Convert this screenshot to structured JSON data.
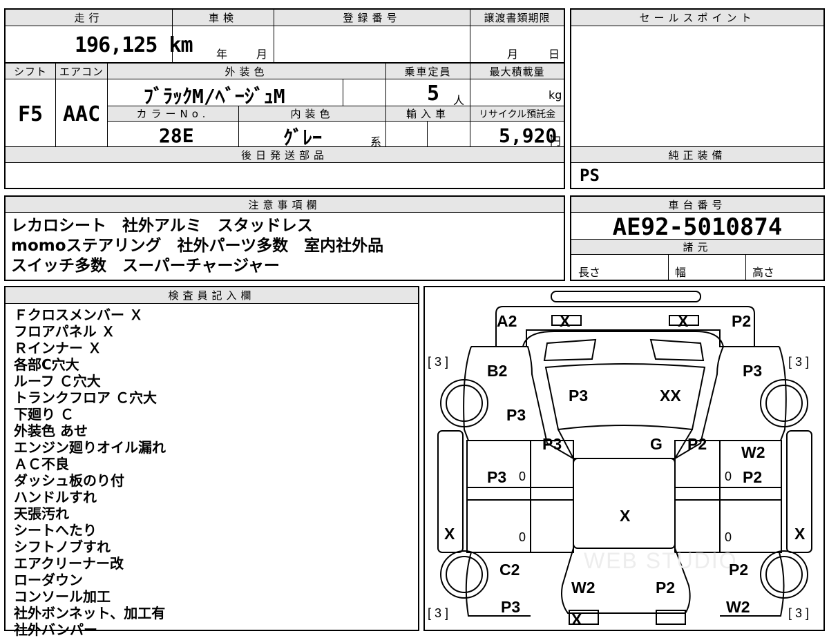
{
  "spec": {
    "mileage_label": "走行",
    "mileage": "196,125 km",
    "inspection_label": "車検",
    "inspection_year": "年",
    "inspection_month": "月",
    "registration_label": "登録番号",
    "transfer_label": "譲渡書類期限",
    "transfer_month": "月",
    "transfer_day": "日",
    "shift_label": "シフト",
    "shift": "F5",
    "aircon_label": "エアコン",
    "aircon": "AAC",
    "exterior_color_label": "外装色",
    "exterior_color": "ﾌﾞﾗｯｸM/ﾍﾞｰｼﾞｭM",
    "capacity_label": "乗車定員",
    "capacity": "5",
    "capacity_unit": "人",
    "max_load_label": "最大積載量",
    "max_load_unit": "kg",
    "color_no_label": "カラーNo.",
    "color_no": "28E",
    "interior_color_label": "内装色",
    "interior_color": "ｸﾞﾚｰ",
    "interior_suffix": "系",
    "import_label": "輸入車",
    "recycle_label": "リサイクル預託金",
    "recycle": "5,920",
    "recycle_unit": "円",
    "later_parts_label": "後日発送部品"
  },
  "sales": {
    "label": "セールスポイント",
    "genuine_label": "純正装備",
    "genuine": "PS"
  },
  "notes": {
    "label": "注意事項欄",
    "lines": [
      "レカロシート　社外アルミ　スタッドレス",
      "momoステアリング　社外パーツ多数　室内社外品",
      "スイッチ多数　スーパーチャージャー"
    ]
  },
  "chassis": {
    "label": "車台番号",
    "number": "AE92-5010874",
    "specs_label": "諸元",
    "length": "長さ",
    "width": "幅",
    "height": "高さ"
  },
  "inspector": {
    "label": "検査員記入欄",
    "lines": [
      "Ｆクロスメンバー Ｘ",
      "フロアパネル Ｘ",
      "Ｒインナー Ｘ",
      "各部C穴大",
      "ルーフ Ｃ穴大",
      "トランクフロア Ｃ穴大",
      "下廻り Ｃ",
      "外装色 あせ",
      "エンジン廻りオイル漏れ",
      "ＡＣ不良",
      "ダッシュ板のり付",
      "ハンドルすれ",
      "天張汚れ",
      "シートへたり",
      "シフトノブすれ",
      "エアクリーナー改",
      "ローダウン",
      "コンソール加工",
      "社外ボンネット、加工有",
      "社外バンパー"
    ]
  },
  "diagram": {
    "watermark": "WEB STUDIO",
    "marks": {
      "rear_left": "A2",
      "rear_x1": "X",
      "rear_x2": "X",
      "rear_right": "P2",
      "tire_rl": "[ 3 ]",
      "tire_rr": "[ 3 ]",
      "rear_qtr_left": "B2",
      "trunk": "P3",
      "trunk_right": "XX",
      "rear_qtr_right": "P3",
      "rear_qtr_left2": "P3",
      "pillar_left": "P3",
      "glass": "G",
      "pillar_right": "P2",
      "rear_door_right": "W2",
      "rear_door_left": "P3",
      "rd_left_num": "0",
      "rd_right_num": "0",
      "rear_door_right2": "P2",
      "roof": "X",
      "sill_left": "X",
      "sill_right": "X",
      "fd_left_num": "0",
      "fd_right_num": "0",
      "front_fender_left": "C2",
      "front_fender_right": "P2",
      "hood_left": "W2",
      "hood_right": "P2",
      "front_left": "P3",
      "front_right": "W2",
      "tire_fl": "[ 3 ]",
      "tire_fr": "[ 3 ]",
      "bumper": "X"
    }
  }
}
